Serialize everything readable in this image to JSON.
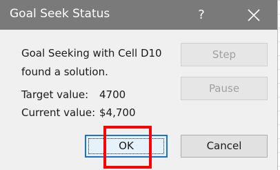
{
  "dialog": {
    "title": "Goal Seek Status",
    "help_glyph": "?",
    "close_icon": "close-icon",
    "message_line1": "Goal Seeking with Cell D10",
    "message_line2": "found a solution.",
    "target_label": "Target value:",
    "target_value": "4700",
    "current_label": "Current value:",
    "current_value": "$4,700",
    "buttons": {
      "step": "Step",
      "pause": "Pause",
      "ok": "OK",
      "cancel": "Cancel"
    }
  },
  "colors": {
    "titlebar": "#7a7a7a",
    "dialog_bg": "#f0f0f0",
    "highlight": "#ff0000",
    "default_button_border": "#1c6fd1"
  }
}
